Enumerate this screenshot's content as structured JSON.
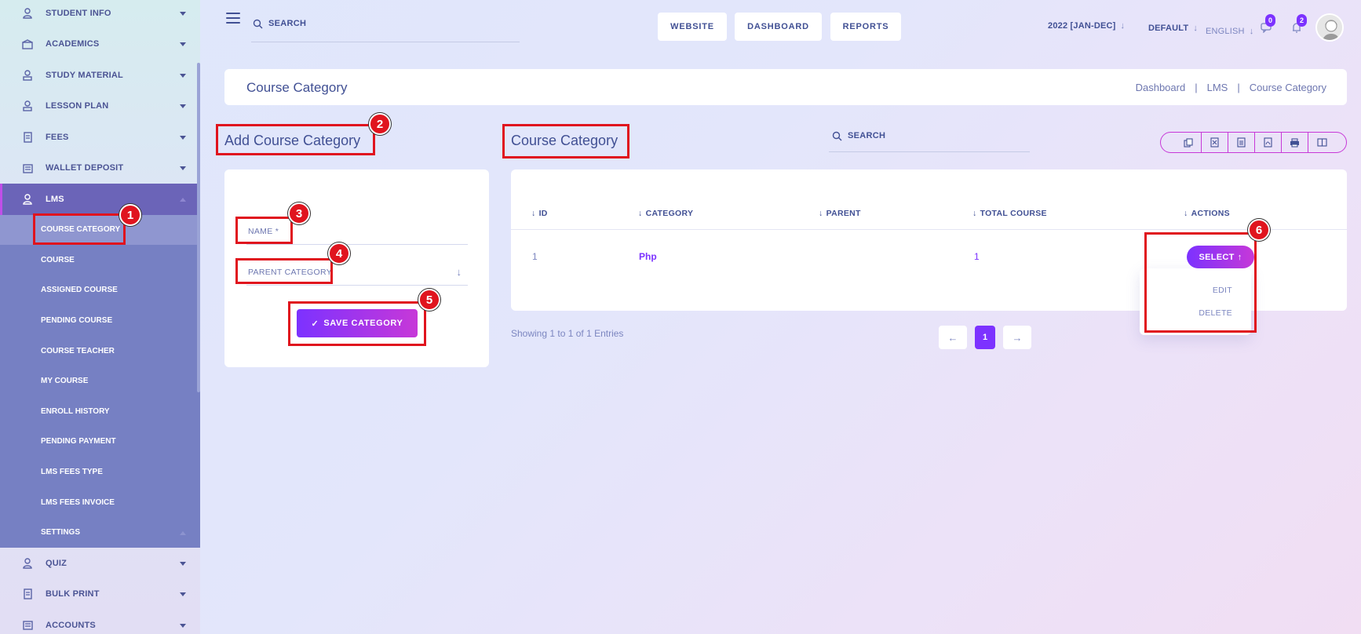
{
  "sidebar": {
    "items_top": [
      {
        "label": "STUDENT INFO",
        "icon": "student-icon"
      },
      {
        "label": "ACADEMICS",
        "icon": "academics-icon"
      },
      {
        "label": "STUDY MATERIAL",
        "icon": "study-material-icon"
      },
      {
        "label": "LESSON PLAN",
        "icon": "lesson-plan-icon"
      },
      {
        "label": "FEES",
        "icon": "fees-icon"
      },
      {
        "label": "WALLET DEPOSIT",
        "icon": "wallet-icon"
      },
      {
        "label": "LMS",
        "icon": "lms-icon"
      }
    ],
    "lms_sub": [
      "COURSE CATEGORY",
      "COURSE",
      "ASSIGNED COURSE",
      "PENDING COURSE",
      "COURSE TEACHER",
      "MY COURSE",
      "ENROLL HISTORY",
      "PENDING PAYMENT",
      "LMS FEES TYPE",
      "LMS FEES INVOICE",
      "SETTINGS"
    ],
    "items_bottom": [
      {
        "label": "QUIZ",
        "icon": "quiz-icon"
      },
      {
        "label": "BULK PRINT",
        "icon": "print-icon"
      },
      {
        "label": "ACCOUNTS",
        "icon": "accounts-icon"
      }
    ]
  },
  "topbar": {
    "search_label": "SEARCH",
    "website": "WEBSITE",
    "dashboard": "DASHBOARD",
    "reports": "REPORTS",
    "session": "2022 [JAN-DEC]",
    "style": "DEFAULT",
    "language": "ENGLISH",
    "messages_count": "0",
    "notifications_count": "2"
  },
  "page": {
    "title": "Course Category",
    "breadcrumb": [
      "Dashboard",
      "LMS",
      "Course Category"
    ]
  },
  "form": {
    "title": "Add Course Category",
    "name_label": "NAME *",
    "parent_label": "PARENT CATEGORY",
    "save_label": "SAVE CATEGORY"
  },
  "list": {
    "title": "Course Category",
    "search_label": "SEARCH",
    "columns": [
      "ID",
      "CATEGORY",
      "PARENT",
      "TOTAL COURSE",
      "ACTIONS"
    ],
    "rows": [
      {
        "id": "1",
        "category": "Php",
        "parent": "",
        "total_course": "1"
      }
    ],
    "select_label": "SELECT",
    "menu": [
      "EDIT",
      "DELETE"
    ],
    "showing": "Showing 1 to 1 of 1 Entries",
    "current_page": "1"
  },
  "annotations": [
    "1",
    "2",
    "3",
    "4",
    "5",
    "6"
  ],
  "colors": {
    "accent": "#7c32ff",
    "accent2": "#c738d8",
    "annotation": "#e0141e",
    "text": "#415094"
  }
}
